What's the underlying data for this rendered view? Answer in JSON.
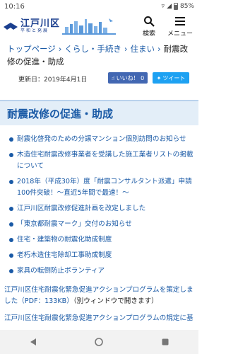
{
  "status": {
    "time": "10:16",
    "battery": "85%"
  },
  "header": {
    "title": "江戸川区",
    "subtitle": "平和と発展",
    "search_label": "検索",
    "menu_label": "メニュー"
  },
  "breadcrumb": {
    "items": [
      "トップページ",
      "くらし・手続き",
      "住まい"
    ],
    "current": "耐震改修の促進・助成"
  },
  "meta": {
    "updated": "更新日：2019年4月1日",
    "like_label": "いいね！ 0",
    "tweet_label": "ツイート"
  },
  "page": {
    "title": "耐震改修の促進・助成"
  },
  "links": [
    "耐震化啓発のための分譲マンション個別訪問のお知らせ",
    "木造住宅耐震改修事業者を受講した施工業者リストの掲載について",
    "2018年（平成30年）度「耐震コンサルタント派遣」申請100件突破！～直近5年間で最速！～",
    "江戸川区耐震改修促進計画を改定しました",
    "「東京都耐震マーク」交付のお知らせ",
    "住宅・建築物の耐震化助成制度",
    "老朽木造住宅除却工事助成制度",
    "家具の転倒防止ボランティア"
  ],
  "paragraph1": {
    "link": "江戸川区住宅耐震化緊急促進アクションプログラムを策定しました（PDF：133KB）",
    "tail": "（別ウィンドウで開きます）"
  },
  "paragraph2": {
    "link": "江戸川区住宅耐震化緊急促進アクションプログラムの規定に基"
  },
  "colors": {
    "link": "#1a5aa6",
    "title_bg": "#e3eef8",
    "facebook": "#4267b2",
    "twitter": "#1da1f2"
  }
}
